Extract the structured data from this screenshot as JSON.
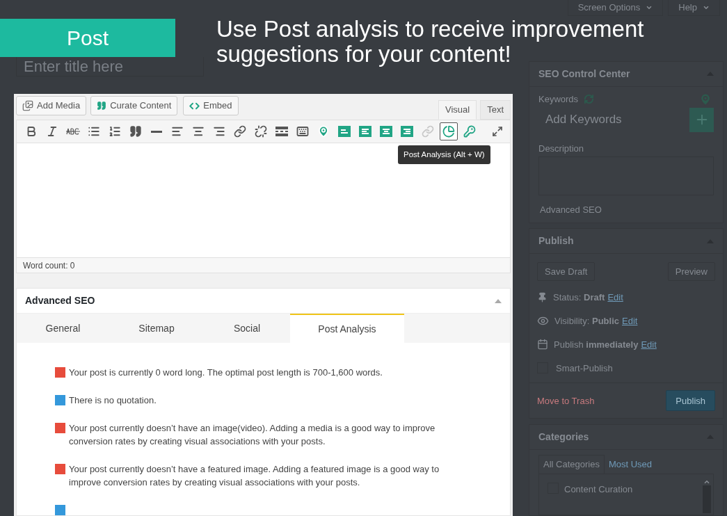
{
  "banner": {
    "label": "Post"
  },
  "callout": "Use Post analysis to receive improvement suggestions for your content!",
  "title_field": {
    "placeholder": "Enter title here"
  },
  "media_buttons": [
    "Add Media",
    "Curate Content",
    "Embed"
  ],
  "editor_tabs": [
    {
      "label": "Visual",
      "selected": true
    },
    {
      "label": "Text",
      "selected": false
    }
  ],
  "toolbar": [
    {
      "selected": false
    },
    {
      "selected": false
    },
    {
      "selected": false
    },
    {
      "selected": false
    },
    {
      "selected": false
    },
    {
      "selected": false
    },
    {
      "selected": false
    },
    {
      "selected": false
    },
    {
      "selected": false
    },
    {
      "selected": false
    },
    {
      "selected": false
    },
    {
      "selected": false
    },
    {
      "selected": false
    },
    {
      "selected": false
    },
    {
      "selected": false
    },
    {
      "selected": false
    },
    {
      "selected": false
    },
    {
      "selected": false
    },
    {
      "selected": false
    },
    {
      "selected": false
    },
    {
      "selected": true
    },
    {
      "selected": false
    }
  ],
  "tooltip": "Post Analysis (Alt + W)",
  "word_count": "Word count: 0",
  "advanced_seo": {
    "title": "Advanced SEO",
    "tabs": [
      {
        "label": "General",
        "selected": false
      },
      {
        "label": "Sitemap",
        "selected": false
      },
      {
        "label": "Social",
        "selected": false
      },
      {
        "label": "Post Analysis",
        "selected": true
      }
    ],
    "items": [
      {
        "color": "#e74c3c",
        "text": "Your post is currently 0 word long. The optimal post length is 700-1,600 words."
      },
      {
        "color": "#3498db",
        "text": "There is no quotation."
      },
      {
        "color": "#e74c3c",
        "text": "Your post currently doesn’t have an image(video). Adding a media is a good way to improve conversion rates by creating visual associations with your posts."
      },
      {
        "color": "#e74c3c",
        "text": "Your post currently doesn’t have a featured image. Adding a featured image is a good way to improve conversion rates by creating visual associations with your posts."
      },
      {
        "color": "#3498db"
      }
    ]
  },
  "top_buttons": [
    "Screen Options",
    "Help"
  ],
  "seo_control_center": {
    "title": "SEO Control Center",
    "keywords_label": "Keywords",
    "keywords_placeholder": "Add Keywords",
    "description_label": "Description",
    "link": "Advanced SEO"
  },
  "publish": {
    "title": "Publish",
    "save_draft": "Save Draft",
    "preview": "Preview",
    "status": {
      "label": "Status:",
      "value": "Draft",
      "link": "Edit"
    },
    "visibility": {
      "label": "Visibility:",
      "value": "Public",
      "link": "Edit"
    },
    "schedule": {
      "label": "Publish",
      "value": "immediately",
      "link": "Edit"
    },
    "smart_publish": {
      "label": "Smart-Publish",
      "checked": false
    },
    "trash": "Move to Trash",
    "publish_button": "Publish"
  },
  "categories": {
    "title": "Categories",
    "tabs": [
      {
        "label": "All Categories",
        "selected": true
      },
      {
        "label": "Most Used",
        "selected": false
      }
    ],
    "items": [
      {
        "label": "Content Curation",
        "checked": false
      }
    ]
  }
}
